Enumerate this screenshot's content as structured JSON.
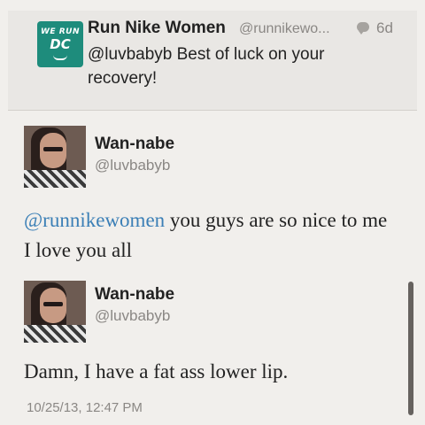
{
  "reply_tweet": {
    "name": "Run Nike Women",
    "handle": "@runnikewo...",
    "time": "6d",
    "text": "@luvbabyb Best of luck on your recovery!",
    "logo": {
      "line1": "WE RUN",
      "line2": "DC"
    }
  },
  "tweet1": {
    "name": "Wan-nabe",
    "handle": "@luvbabyb",
    "mention": "@runnikewomen",
    "text": " you guys are so nice to me I love you all"
  },
  "tweet2": {
    "name": "Wan-nabe",
    "handle": "@luvbabyb",
    "text": "Damn, I have a fat ass lower lip.",
    "timestamp": "10/25/13, 12:47 PM"
  },
  "icons": {
    "reply_bubble": "speech-bubble-icon",
    "avatar": "avatar"
  },
  "colors": {
    "mention": "#3b7fb6",
    "logo_bg": "#1e8c7c",
    "background": "#f1efec"
  }
}
